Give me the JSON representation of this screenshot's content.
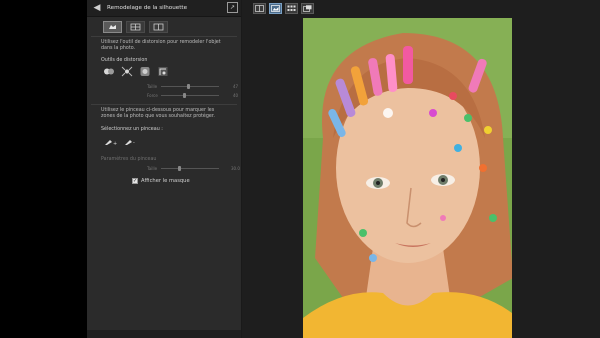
{
  "panel": {
    "title": "Remodelage de la silhouette",
    "description": "Utilisez l'outil de distorsion pour remodeler l'objet dans la photo.",
    "tools_heading": "Outils de distorsion",
    "tools": [
      {
        "name": "warp-icon"
      },
      {
        "name": "pinch-icon"
      },
      {
        "name": "bloat-icon"
      },
      {
        "name": "twirl-icon"
      }
    ],
    "sliders": [
      {
        "label": "Taille",
        "value": "47",
        "level": 0.47
      },
      {
        "label": "Force",
        "value": "40",
        "level": 0.4
      }
    ],
    "protect_text": "Utilisez le pinceau ci-dessous pour marquer les zones de la photo que vous souhaitez protéger.",
    "select_brush": "Sélectionnez un pinceau :",
    "brushes": [
      {
        "name": "protect-brush-icon"
      },
      {
        "name": "eraser-brush-icon"
      }
    ],
    "brush_params_heading": "Paramètres du pinceau",
    "brush_slider": {
      "label": "Taille",
      "value": "30.0",
      "level": 0.3
    },
    "show_mask_label": "Afficher le masque",
    "show_mask_checked": true
  },
  "toolbar": {
    "buttons": [
      {
        "name": "compare-view-icon"
      },
      {
        "name": "single-view-icon"
      },
      {
        "name": "grid-view-icon"
      },
      {
        "name": "fit-screen-icon"
      }
    ],
    "active_index": 1
  },
  "colors": {
    "panel_bg": "#2b2b2b",
    "header_bg": "#202020",
    "photo_bg": "#7aa64a",
    "hair": "#c27a4c",
    "shirt": "#f2b632"
  }
}
